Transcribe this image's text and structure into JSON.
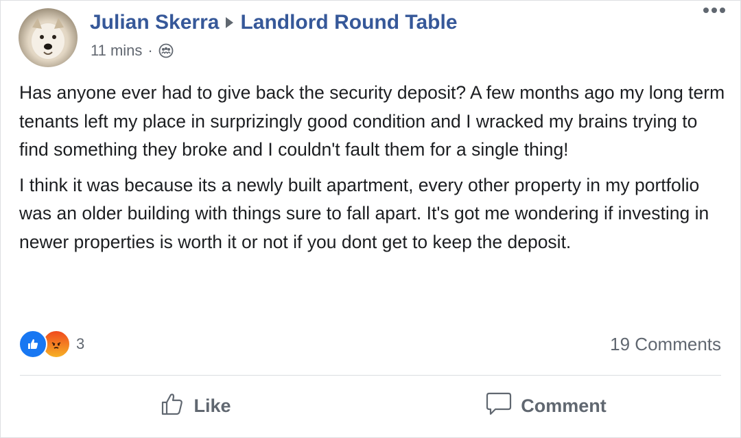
{
  "post": {
    "author": "Julian Skerra",
    "group": "Landlord Round Table",
    "time": "11 mins",
    "separator": "·",
    "privacy_icon": "group-icon",
    "paragraphs": [
      "Has anyone ever had to give back the security deposit? A few months ago my long term tenants left my place in surprizingly good condition and I wracked my brains trying to find something they broke and I couldn't fault them for a single thing!",
      "I think it was because its a newly built apartment, every other property in my portfolio was an older building with things sure to fall apart. It's got me wondering if investing in newer properties is worth it or not if you dont get to keep the deposit."
    ],
    "reactions": {
      "types": [
        "like-reaction-icon",
        "angry-reaction-icon"
      ],
      "count": "3"
    },
    "comments_count": "19 Comments",
    "actions": {
      "like": "Like",
      "comment": "Comment"
    }
  },
  "colors": {
    "link": "#365899",
    "meta": "#616770",
    "like_blue": "#1877f2",
    "angry_orange": "#f04a1e"
  }
}
